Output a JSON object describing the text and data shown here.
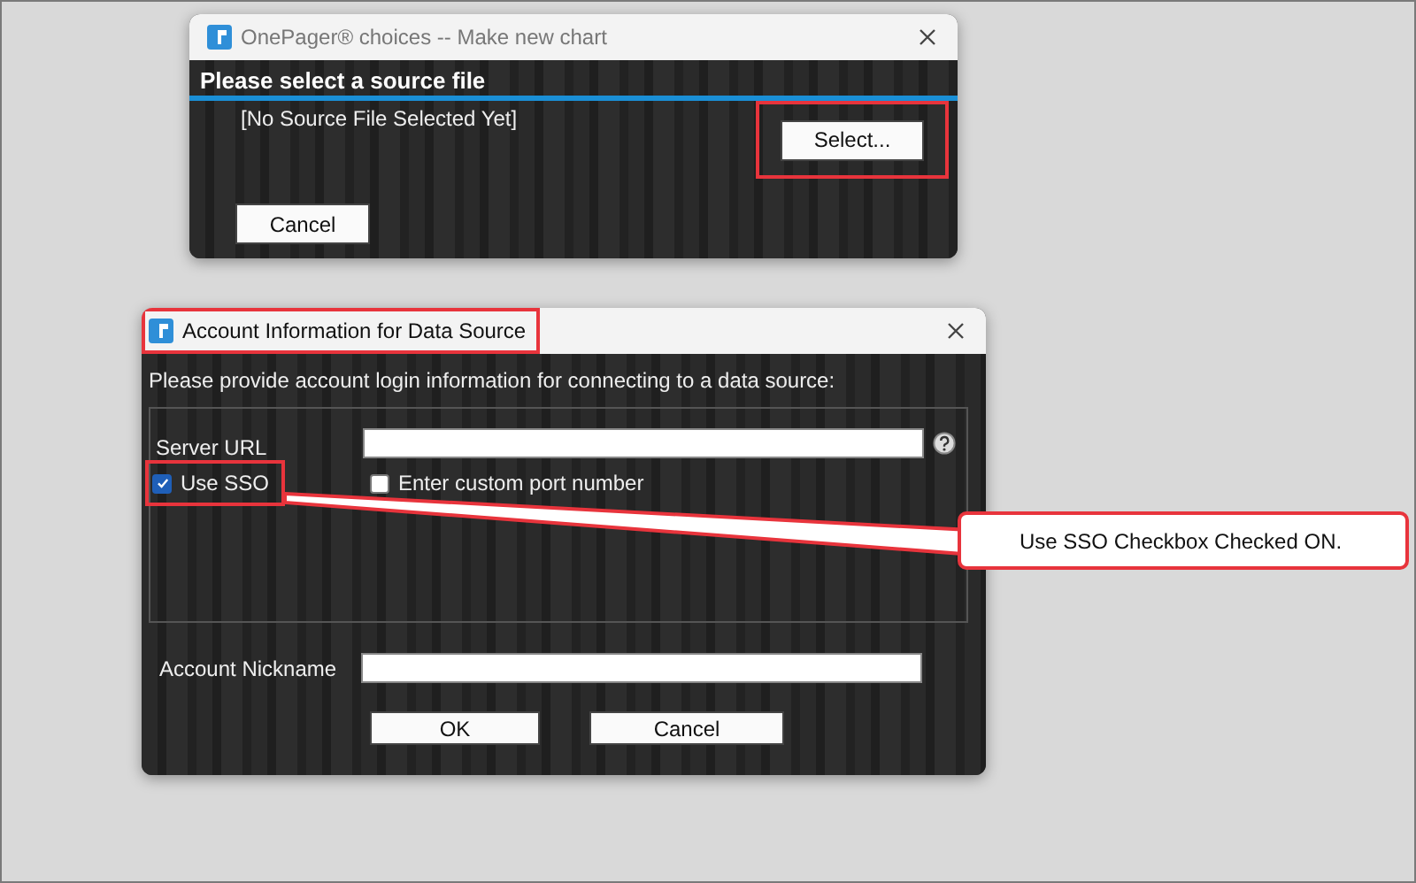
{
  "source_dialog": {
    "title": "OnePager® choices -- Make new chart",
    "heading": "Please select a source file",
    "file_status": "[No Source File Selected Yet]",
    "buttons": [
      {
        "kind": "select",
        "label": "Select...",
        "highlighted": true
      },
      {
        "kind": "cancel",
        "label": "Cancel",
        "highlighted": false
      }
    ]
  },
  "account_dialog": {
    "title": "Account Information for Data Source",
    "title_highlighted": true,
    "instruction": "Please provide account login information for connecting to a data source:",
    "server_url_label": "Server URL",
    "checkboxes": [
      {
        "label": "Use SSO",
        "checked": true,
        "highlighted": true
      },
      {
        "label": "Enter custom port number",
        "checked": false,
        "highlighted": false
      }
    ],
    "nickname_label": "Account Nickname",
    "buttons": [
      "OK",
      "Cancel"
    ]
  },
  "callout": {
    "text": "Use SSO Checkbox Checked ON."
  }
}
